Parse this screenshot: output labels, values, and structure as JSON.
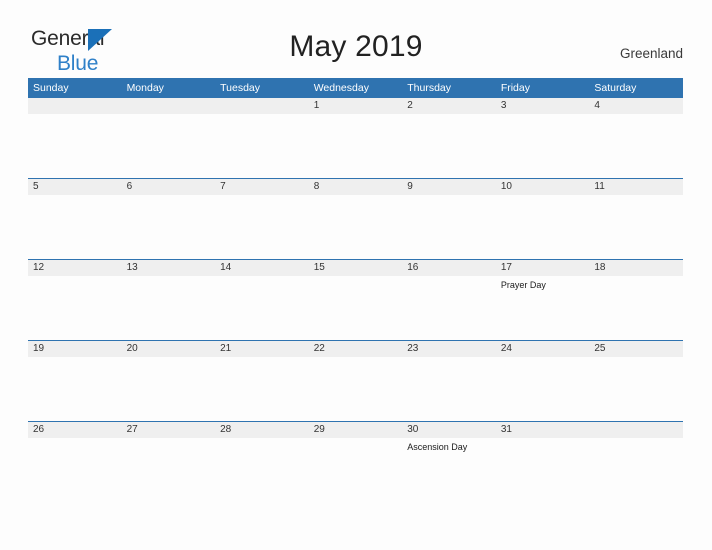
{
  "brand": {
    "name_top": "General",
    "name_bottom": "Blue",
    "flag_color": "#1b70b8",
    "blue_text_color": "#2f80c8"
  },
  "header": {
    "title": "May 2019",
    "region": "Greenland"
  },
  "theme": {
    "header_blue": "#2f73b0",
    "band_gray": "#efefef",
    "page_background": "#fdfdfd",
    "rule_blue": "#2f73b0"
  },
  "calendar": {
    "weekday_headers": [
      "Sunday",
      "Monday",
      "Tuesday",
      "Wednesday",
      "Thursday",
      "Friday",
      "Saturday"
    ],
    "weeks": [
      [
        {
          "day": "",
          "event": ""
        },
        {
          "day": "",
          "event": ""
        },
        {
          "day": "",
          "event": ""
        },
        {
          "day": "1",
          "event": ""
        },
        {
          "day": "2",
          "event": ""
        },
        {
          "day": "3",
          "event": ""
        },
        {
          "day": "4",
          "event": ""
        }
      ],
      [
        {
          "day": "5",
          "event": ""
        },
        {
          "day": "6",
          "event": ""
        },
        {
          "day": "7",
          "event": ""
        },
        {
          "day": "8",
          "event": ""
        },
        {
          "day": "9",
          "event": ""
        },
        {
          "day": "10",
          "event": ""
        },
        {
          "day": "11",
          "event": ""
        }
      ],
      [
        {
          "day": "12",
          "event": ""
        },
        {
          "day": "13",
          "event": ""
        },
        {
          "day": "14",
          "event": ""
        },
        {
          "day": "15",
          "event": ""
        },
        {
          "day": "16",
          "event": ""
        },
        {
          "day": "17",
          "event": "Prayer Day"
        },
        {
          "day": "18",
          "event": ""
        }
      ],
      [
        {
          "day": "19",
          "event": ""
        },
        {
          "day": "20",
          "event": ""
        },
        {
          "day": "21",
          "event": ""
        },
        {
          "day": "22",
          "event": ""
        },
        {
          "day": "23",
          "event": ""
        },
        {
          "day": "24",
          "event": ""
        },
        {
          "day": "25",
          "event": ""
        }
      ],
      [
        {
          "day": "26",
          "event": ""
        },
        {
          "day": "27",
          "event": ""
        },
        {
          "day": "28",
          "event": ""
        },
        {
          "day": "29",
          "event": ""
        },
        {
          "day": "30",
          "event": "Ascension Day"
        },
        {
          "day": "31",
          "event": ""
        },
        {
          "day": "",
          "event": ""
        }
      ]
    ]
  }
}
